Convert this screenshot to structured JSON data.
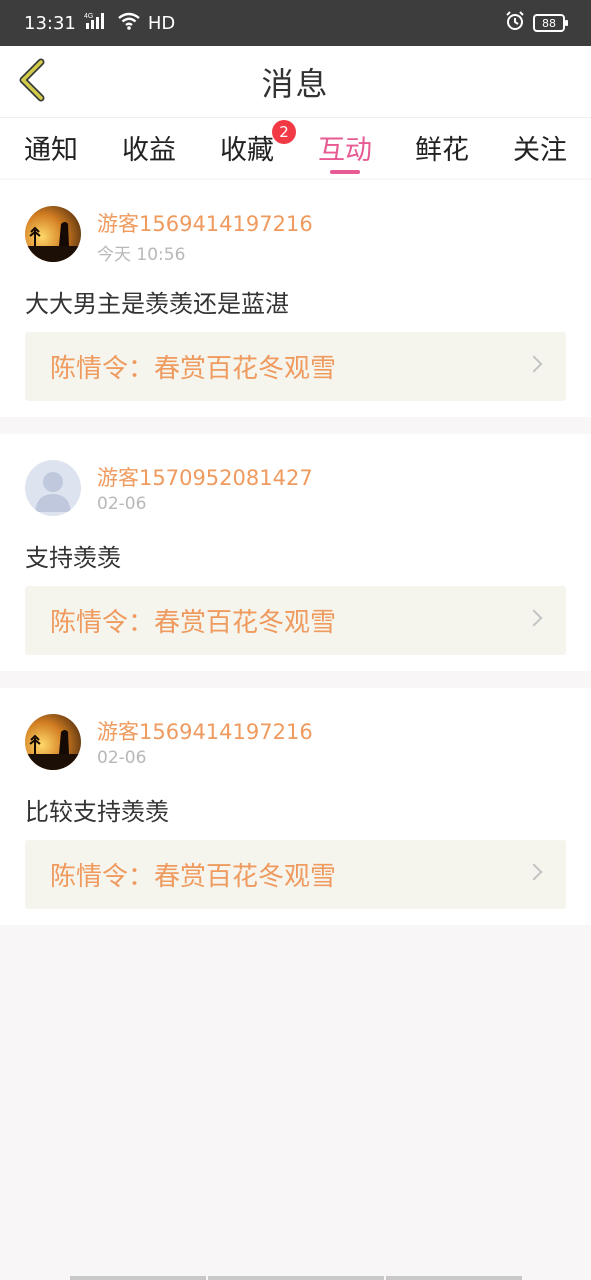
{
  "status_bar": {
    "time": "13:31",
    "network": "4G",
    "hd": "HD",
    "battery": "88"
  },
  "header": {
    "title": "消息",
    "back_icon": "chevron-left-icon",
    "back_color": "#d2cc4a"
  },
  "tabs": [
    {
      "label": "通知",
      "active": false
    },
    {
      "label": "收益",
      "active": false
    },
    {
      "label": "收藏",
      "active": false,
      "badge": "2"
    },
    {
      "label": "互动",
      "active": true
    },
    {
      "label": "鲜花",
      "active": false
    },
    {
      "label": "关注",
      "active": false
    }
  ],
  "colors": {
    "accent": "#e75a93",
    "username": "#ef9a5e",
    "badge": "#f23a45"
  },
  "messages": [
    {
      "username": "游客1569414197216",
      "time": "今天 10:56",
      "comment": "大大男主是羡羡还是蓝湛",
      "book": "陈情令：春赏百花冬观雪",
      "avatar": "sunset-photo"
    },
    {
      "username": "游客1570952081427",
      "time": "02-06",
      "comment": "支持羡羡",
      "book": "陈情令：春赏百花冬观雪",
      "avatar": "default-user"
    },
    {
      "username": "游客1569414197216",
      "time": "02-06",
      "comment": "比较支持羡羡",
      "book": "陈情令：春赏百花冬观雪",
      "avatar": "sunset-photo"
    }
  ]
}
